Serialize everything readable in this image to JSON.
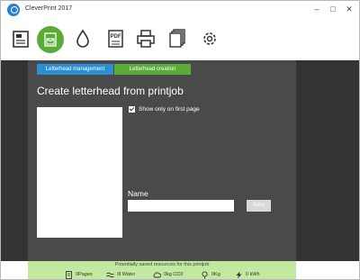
{
  "window": {
    "title": "CleverPrint 2017",
    "minimize": "–",
    "maximize": "□",
    "close": "✕"
  },
  "toolbar": {
    "items": [
      {
        "name": "document-icon"
      },
      {
        "name": "letterhead-icon",
        "active": true
      },
      {
        "name": "ink-drop-icon"
      },
      {
        "name": "pdf-icon"
      },
      {
        "name": "printer-icon"
      },
      {
        "name": "copies-icon"
      },
      {
        "name": "settings-icon"
      }
    ]
  },
  "tabs": {
    "management": "Letterhead management",
    "creation": "Letterhead creation"
  },
  "main": {
    "heading": "Create letterhead from printjob",
    "checkbox_label": "Show only on first page",
    "checkbox_checked": true,
    "name_label": "Name",
    "name_value": "",
    "save_label": "Save"
  },
  "footer": {
    "caption": "Potentially saved resources for this printjob",
    "stats": {
      "pages": "0Pages",
      "water": "0l Water",
      "co2": "0kg CO2",
      "kg": "0Kg",
      "energy": "0 kWh"
    }
  },
  "colors": {
    "accent_green": "#5aab38",
    "accent_blue": "#2b8fd6",
    "footer_bg": "#c3e89f",
    "panel_bg": "#4a4a4a"
  }
}
